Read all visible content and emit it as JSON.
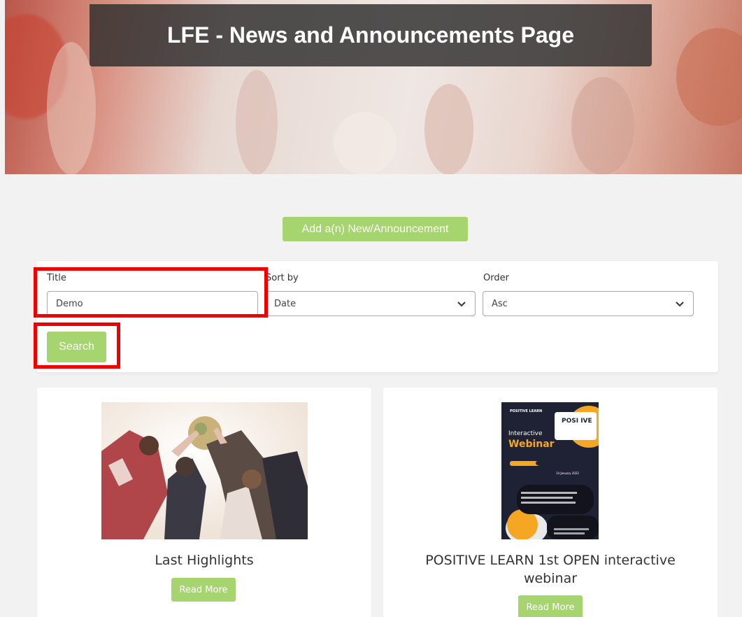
{
  "hero": {
    "title": "LFE - News and Announcements Page"
  },
  "actions": {
    "add_label": "Add a(n) New/Announcement"
  },
  "filters": {
    "title_label": "Title",
    "title_value": "Demo",
    "sort_label": "Sort by",
    "sort_value": "Date",
    "order_label": "Order",
    "order_value": "Asc",
    "search_label": "Search"
  },
  "cards": [
    {
      "title": "Last Highlights",
      "button": "Read More"
    },
    {
      "title_line1": "POSITIVE LEARN 1st OPEN interactive",
      "title_line2": "webinar",
      "button": "Read More"
    }
  ],
  "poster": {
    "brand": "POSITIVE LEARN",
    "logo": "POSI IVE",
    "line1": "Interactive",
    "line2": "Webinar",
    "date": "14 January 2022"
  },
  "colors": {
    "accent_green": "#a6d46e",
    "highlight_red": "#ee0000",
    "poster_orange": "#f5a623",
    "poster_navy": "#1f2234"
  }
}
